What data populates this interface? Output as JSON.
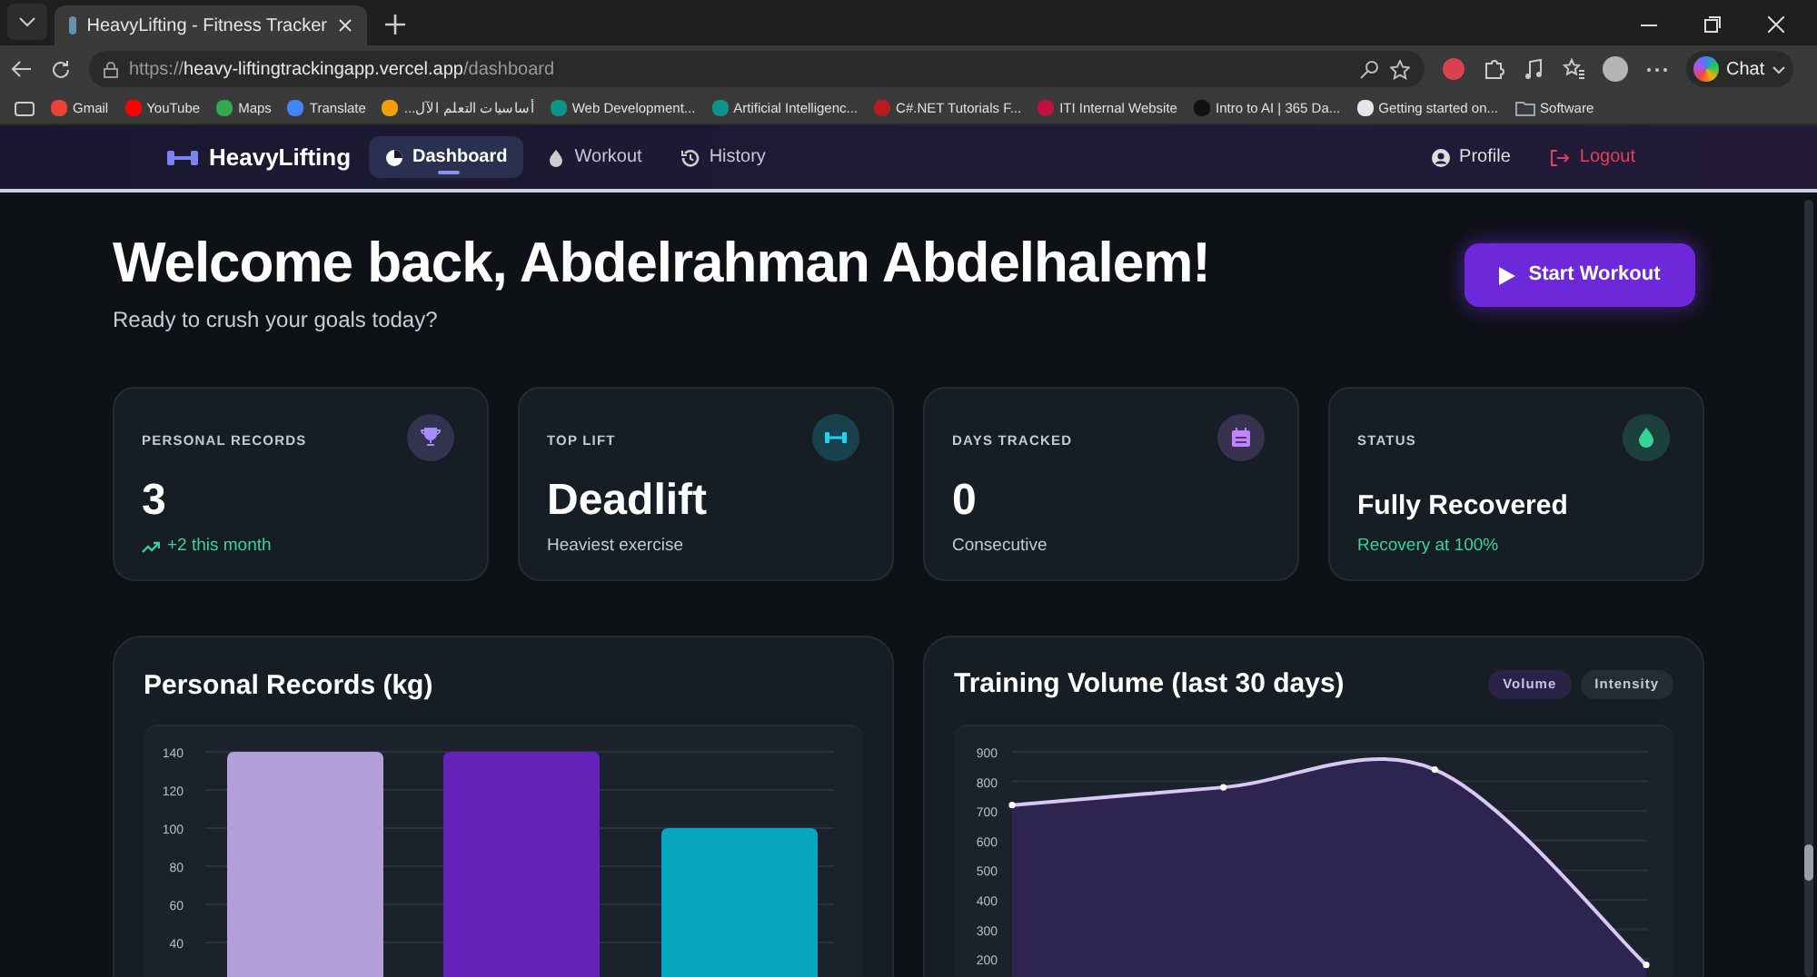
{
  "browser": {
    "tab_title": "HeavyLifting - Fitness Tracker",
    "url_scheme": "https://",
    "url_host": "heavy-liftingtrackingapp.vercel.app",
    "url_path": "/dashboard",
    "chat_label": "Chat",
    "bookmarks": [
      {
        "label": "Gmail",
        "kind": "site",
        "color": "#ea4335"
      },
      {
        "label": "YouTube",
        "kind": "site",
        "color": "#ff0000"
      },
      {
        "label": "Maps",
        "kind": "site",
        "color": "#34a853"
      },
      {
        "label": "Translate",
        "kind": "site",
        "color": "#4285f4"
      },
      {
        "label": "أساسيات التعلم الآل...",
        "kind": "site",
        "color": "#f59e0b"
      },
      {
        "label": "Web Development...",
        "kind": "site",
        "color": "#0d9488"
      },
      {
        "label": "Artificial Intelligenc...",
        "kind": "site",
        "color": "#0d9488"
      },
      {
        "label": "C#.NET Tutorials F...",
        "kind": "site",
        "color": "#b91c1c"
      },
      {
        "label": "ITI Internal Website",
        "kind": "site",
        "color": "#be123c"
      },
      {
        "label": "Intro to AI | 365 Da...",
        "kind": "site",
        "color": "#111111"
      },
      {
        "label": "Getting started on...",
        "kind": "site",
        "color": "#e5e7eb"
      },
      {
        "label": "Software",
        "kind": "folder",
        "color": "#9ca3af"
      }
    ]
  },
  "app": {
    "brand": "HeavyLifting",
    "nav": [
      {
        "label": "Dashboard",
        "selected": true
      },
      {
        "label": "Workout",
        "selected": false
      },
      {
        "label": "History",
        "selected": false
      }
    ],
    "profile": "Profile",
    "logout": "Logout"
  },
  "welcome": {
    "title": "Welcome back, Abdelrahman Abdelhalem!",
    "subtitle": "Ready to crush your goals today?",
    "action": "Start Workout"
  },
  "stats": [
    {
      "label": "PERSONAL RECORDS",
      "value": "3",
      "note": "+2 this month",
      "kind": "trend",
      "color": "#a78bfa"
    },
    {
      "label": "TOP LIFT",
      "value": "Deadlift",
      "note": "Heaviest exercise",
      "kind": "muted",
      "color": "#22d3ee"
    },
    {
      "label": "DAYS TRACKED",
      "value": "0",
      "note": "Consecutive",
      "kind": "muted",
      "color": "#c084fc"
    },
    {
      "label": "STATUS",
      "value": "Fully Recovered",
      "note": "Recovery at 100%",
      "kind": "good",
      "color": "#34d399"
    }
  ],
  "records": {
    "chart_data": {
      "type": "bar",
      "title": "Personal Records (kg)",
      "values": [
        140,
        140,
        100
      ],
      "colors": [
        "#b39ddb",
        "#6423b8",
        "#09a6bf"
      ],
      "grid": true,
      "ylim": [
        0,
        140
      ],
      "yticks": [
        40,
        60,
        80,
        100,
        120,
        140
      ]
    }
  },
  "volume": {
    "toggles": [
      {
        "label": "Volume",
        "selected": true
      },
      {
        "label": "Intensity",
        "selected": false
      }
    ],
    "chart_data": {
      "type": "area",
      "title": "Training Volume (last 30 days)",
      "values": [
        720,
        780,
        840,
        180
      ],
      "grid": true,
      "ylim": [
        0,
        900
      ],
      "yticks": [
        200,
        300,
        400,
        500,
        600,
        700,
        800,
        900
      ]
    }
  }
}
